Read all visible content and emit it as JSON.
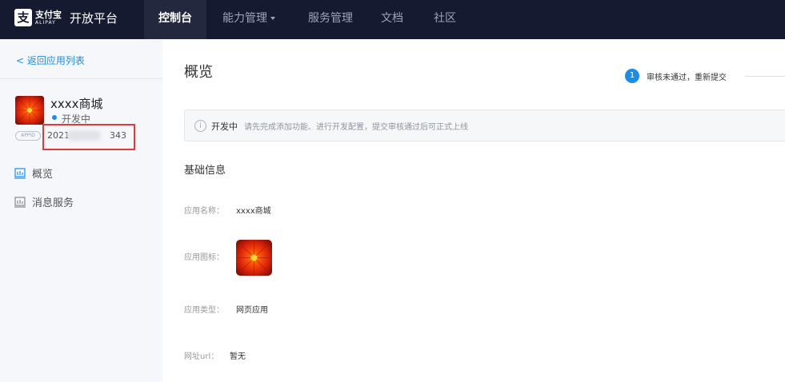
{
  "nav": {
    "logo_cn": "支付宝",
    "logo_en": "ALIPAY",
    "platform_title": "开放平台",
    "tabs": [
      {
        "label": "控制台"
      },
      {
        "label": "能力管理"
      },
      {
        "label": "服务管理"
      },
      {
        "label": "文档"
      },
      {
        "label": "社区"
      }
    ]
  },
  "sidebar": {
    "back_label": "< 返回应用列表",
    "app_name": "xxxx商城",
    "status": "开发中",
    "appid_badge": "APPID",
    "appid_prefix": "2021",
    "appid_suffix": "343",
    "items": [
      {
        "label": "概览",
        "icon": "chart-bar-icon"
      },
      {
        "label": "消息服务",
        "icon": "chart-bar-icon"
      }
    ]
  },
  "main": {
    "title": "概览",
    "step": {
      "number": "1",
      "label": "审核未通过，重新提交"
    },
    "notice": {
      "strong": "开发中",
      "text": "请先完成添加功能、进行开发配置，提交审核通过后可正式上线"
    },
    "section_title": "基础信息",
    "fields": [
      {
        "label": "应用名称：",
        "value": "xxxx商城"
      },
      {
        "label": "应用图标：",
        "value": ""
      },
      {
        "label": "应用类型：",
        "value": "网页应用"
      },
      {
        "label": "网址url：",
        "value": "暂无"
      }
    ]
  },
  "colors": {
    "nav_bg": "#161a30",
    "accent": "#1a8ee6",
    "highlight": "#e03a3a"
  }
}
